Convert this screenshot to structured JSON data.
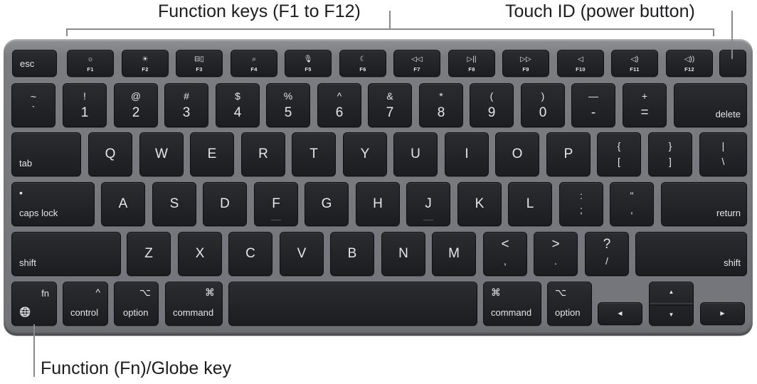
{
  "callouts": {
    "function_keys": "Function keys (F1 to F12)",
    "touch_id": "Touch ID (power button)",
    "fn_globe": "Function (Fn)/Globe key"
  },
  "colors": {
    "key_face": "#1f2023",
    "frame": "#7b7c80",
    "legend_text": "#e6e6e8",
    "callout_text": "#1d1d1f",
    "leader_line": "#8a8a8e"
  },
  "row_function": {
    "esc": "esc",
    "keys": [
      {
        "label": "F1",
        "icon": "brightness-down-icon",
        "glyph": "☼"
      },
      {
        "label": "F2",
        "icon": "brightness-up-icon",
        "glyph": "☀"
      },
      {
        "label": "F3",
        "icon": "mission-control-icon",
        "glyph": "⊟▯"
      },
      {
        "label": "F4",
        "icon": "search-icon",
        "glyph": "⌕"
      },
      {
        "label": "F5",
        "icon": "microphone-icon",
        "glyph": "🎙"
      },
      {
        "label": "F6",
        "icon": "moon-icon",
        "glyph": "☾"
      },
      {
        "label": "F7",
        "icon": "rewind-icon",
        "glyph": "◁◁"
      },
      {
        "label": "F8",
        "icon": "play-pause-icon",
        "glyph": "▷||"
      },
      {
        "label": "F9",
        "icon": "fast-forward-icon",
        "glyph": "▷▷"
      },
      {
        "label": "F10",
        "icon": "mute-icon",
        "glyph": "◁"
      },
      {
        "label": "F11",
        "icon": "volume-down-icon",
        "glyph": "◁)"
      },
      {
        "label": "F12",
        "icon": "volume-up-icon",
        "glyph": "◁))"
      }
    ]
  },
  "row_number": {
    "keys": [
      {
        "top": "~",
        "bottom": "`"
      },
      {
        "top": "!",
        "bottom": "1"
      },
      {
        "top": "@",
        "bottom": "2"
      },
      {
        "top": "#",
        "bottom": "3"
      },
      {
        "top": "$",
        "bottom": "4"
      },
      {
        "top": "%",
        "bottom": "5"
      },
      {
        "top": "^",
        "bottom": "6"
      },
      {
        "top": "&",
        "bottom": "7"
      },
      {
        "top": "*",
        "bottom": "8"
      },
      {
        "top": "(",
        "bottom": "9"
      },
      {
        "top": ")",
        "bottom": "0"
      },
      {
        "top": "—",
        "bottom": "-"
      },
      {
        "top": "+",
        "bottom": "="
      }
    ],
    "delete": "delete"
  },
  "row_qwerty": {
    "tab": "tab",
    "letters": [
      "Q",
      "W",
      "E",
      "R",
      "T",
      "Y",
      "U",
      "I",
      "O",
      "P"
    ],
    "brackets": [
      {
        "top": "{",
        "bottom": "["
      },
      {
        "top": "}",
        "bottom": "]"
      },
      {
        "top": "|",
        "bottom": "\\"
      }
    ]
  },
  "row_home": {
    "caps_lock": "caps lock",
    "caps_indicator": "•",
    "letters": [
      "A",
      "S",
      "D",
      "F",
      "G",
      "H",
      "J",
      "K",
      "L"
    ],
    "punct": [
      {
        "top": ":",
        "bottom": ";"
      },
      {
        "top": "\"",
        "bottom": ","
      }
    ],
    "return": "return"
  },
  "row_shift": {
    "shift_left": "shift",
    "letters": [
      "Z",
      "X",
      "C",
      "V",
      "B",
      "N",
      "M"
    ],
    "punct": [
      {
        "top": "<",
        "bottom": ","
      },
      {
        "top": ">",
        "bottom": "."
      },
      {
        "top": "?",
        "bottom": "/"
      }
    ],
    "shift_right": "shift"
  },
  "row_bottom": {
    "fn": "fn",
    "globe_glyph": "🌐",
    "control": "control",
    "control_glyph": "^",
    "option": "option",
    "option_glyph": "⌥",
    "command": "command",
    "command_glyph": "⌘",
    "arrow_left": "◀",
    "arrow_up": "▲",
    "arrow_down": "▼",
    "arrow_right": "▶"
  }
}
